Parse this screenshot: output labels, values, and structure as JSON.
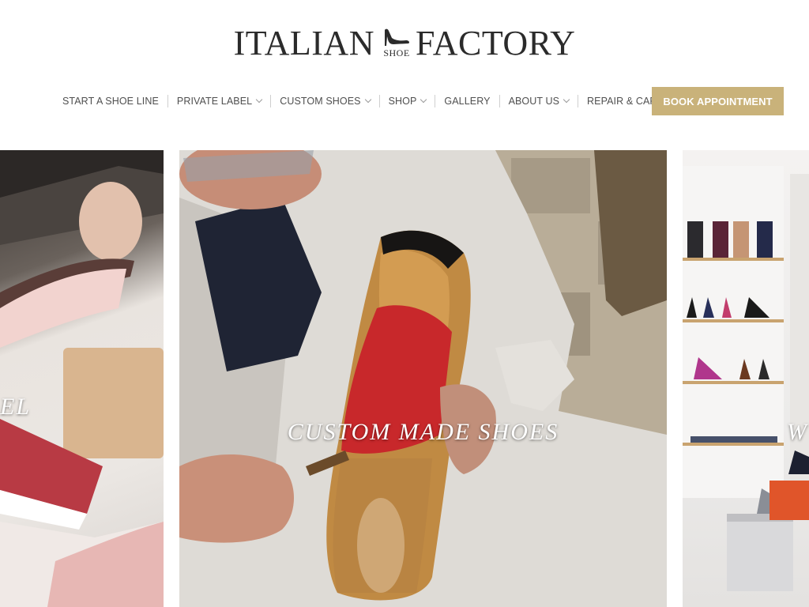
{
  "brand": {
    "word1": "ITALIAN",
    "shoe_small": "SHOE",
    "word2": "FACTORY",
    "logo_icon": "high-heel-icon"
  },
  "nav": {
    "items": [
      {
        "label": "START A SHOE LINE",
        "has_dropdown": false
      },
      {
        "label": "PRIVATE LABEL",
        "has_dropdown": true
      },
      {
        "label": "CUSTOM SHOES",
        "has_dropdown": true
      },
      {
        "label": "SHOP",
        "has_dropdown": true
      },
      {
        "label": "GALLERY",
        "has_dropdown": false
      },
      {
        "label": "ABOUT US",
        "has_dropdown": true
      },
      {
        "label": "REPAIR & CARE",
        "has_dropdown": true
      }
    ],
    "cta_label": "BOOK APPOINTMENT",
    "cta_color": "#c9b27a",
    "dropdown_icon": "chevron-down-icon"
  },
  "slides": {
    "left_title": "EL",
    "center_title": "CUSTOM MADE SHOES",
    "right_title": "W"
  }
}
